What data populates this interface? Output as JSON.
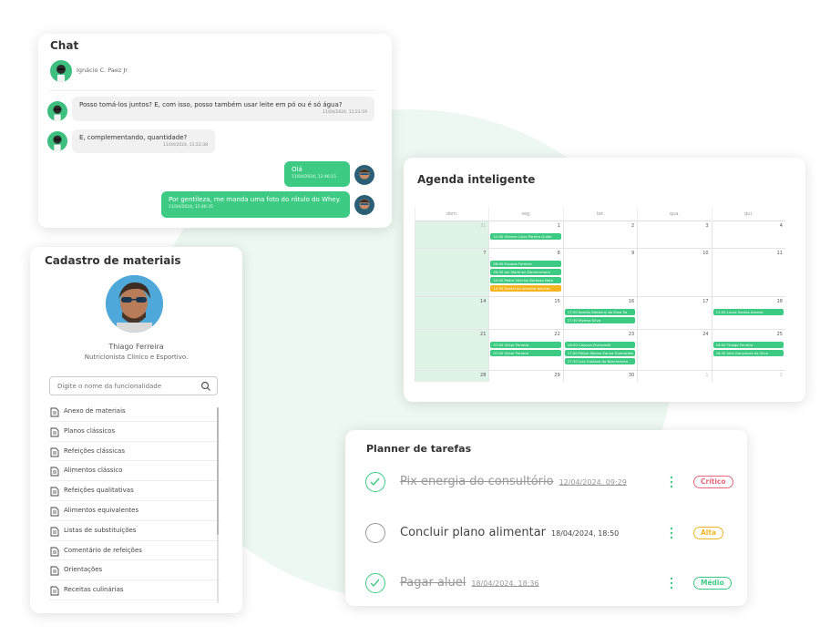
{
  "chat": {
    "title": "Chat",
    "contact_name": "Ignácio C. Paez Jr",
    "messages": [
      {
        "text": "Posso tomá-los juntos? E, com isso, posso também usar leite em pó ou é só água?",
        "time": "11/04/2024, 11:21:59",
        "direction": "in"
      },
      {
        "text": "E, complementando, quantidade?",
        "time": "11/04/2024, 11:22:38",
        "direction": "in"
      },
      {
        "text": "Olá",
        "time": "11/04/2024, 12:46:15",
        "direction": "out"
      },
      {
        "text": "Por gentileza, me manda uma foto do rótulo do Whey.",
        "time": "11/04/2024, 12:46:35",
        "direction": "out"
      }
    ]
  },
  "agenda": {
    "title": "Agenda inteligente",
    "weekdays": [
      "dom.",
      "seg.",
      "ter.",
      "qua.",
      "qui."
    ],
    "weeks": [
      {
        "days": [
          "31",
          "1",
          "2",
          "3",
          "4"
        ],
        "dim": [
          true,
          false,
          false,
          false,
          false
        ],
        "events": [
          {
            "col": 1,
            "slot": 0,
            "text": "11:00 Viviane Lucia Pereira Guiler",
            "color": "green"
          }
        ]
      },
      {
        "days": [
          "7",
          "8",
          "9",
          "10",
          "11"
        ],
        "dim": [
          false,
          false,
          false,
          false,
          false
        ],
        "events": [
          {
            "col": 1,
            "slot": 0,
            "text": "08:00 Enoque Ferreira",
            "color": "green"
          },
          {
            "col": 1,
            "slot": 1,
            "text": "09:30 Ian Martinez Zimmermann",
            "color": "green"
          },
          {
            "col": 1,
            "slot": 2,
            "text": "10:00 Pedro Vinicíus Barbosa Neto",
            "color": "green"
          },
          {
            "col": 1,
            "slot": 3,
            "text": "10:30 Daniel de Almeida Barreto",
            "color": "orange"
          }
        ]
      },
      {
        "days": [
          "14",
          "15",
          "16",
          "17",
          "18"
        ],
        "dim": [
          false,
          false,
          false,
          false,
          false
        ],
        "events": [
          {
            "col": 2,
            "slot": 0,
            "text": "17:00 Kamila Stefanny da Silva Sa",
            "color": "green"
          },
          {
            "col": 2,
            "slot": 1,
            "text": "17:30 Mylena Silva",
            "color": "green"
          },
          {
            "col": 4,
            "slot": 0,
            "text": "11:00 Lucas Santos Amaral",
            "color": "green"
          }
        ]
      },
      {
        "days": [
          "21",
          "22",
          "23",
          "24",
          "25"
        ],
        "dim": [
          false,
          false,
          false,
          false,
          false
        ],
        "events": [
          {
            "col": 1,
            "slot": 0,
            "text": "07:00 Victor Ferreira",
            "color": "green"
          },
          {
            "col": 1,
            "slot": 1,
            "text": "07:00 Victor Ferreira",
            "color": "green"
          },
          {
            "col": 2,
            "slot": 0,
            "text": "16:30 Clayson Portucedil",
            "color": "green"
          },
          {
            "col": 2,
            "slot": 1,
            "text": "17:00 Felipe Afonso Zanna Guimarães",
            "color": "green"
          },
          {
            "col": 2,
            "slot": 2,
            "text": "17:30 Luis Gustavo do Nascimento",
            "color": "green"
          },
          {
            "col": 4,
            "slot": 0,
            "text": "16:00 Thiago Ferreira",
            "color": "green"
          },
          {
            "col": 4,
            "slot": 1,
            "text": "16:30 Júlio Gonçalves da Silva",
            "color": "green"
          }
        ]
      },
      {
        "days": [
          "28",
          "29",
          "30",
          "1",
          "2"
        ],
        "dim": [
          false,
          false,
          false,
          true,
          true
        ],
        "events": []
      }
    ]
  },
  "cadastro": {
    "title": "Cadastro de materiais",
    "name": "Thiago Ferreira",
    "role": "Nutricionista Clínico e Esportivo.",
    "search_placeholder": "Digite o nome da funcionalidade",
    "items": [
      "Anexo de materiais",
      "Planos clássicos",
      "Refeições clássicas",
      "Alimentos clássico",
      "Refeições qualitativas",
      "Alimentos equivalentes",
      "Listas de substituições",
      "Comentário de refeições",
      "Orientações",
      "Receitas culinárias"
    ]
  },
  "planner": {
    "title": "Planner de tarefas",
    "tasks": [
      {
        "name": "Pix energia do consultório",
        "date": "12/04/2024, 09:29",
        "done": true,
        "priority": "Crítico",
        "priority_color": "#e8677a"
      },
      {
        "name": "Concluir plano alimentar",
        "date": "18/04/2024, 18:50",
        "done": false,
        "priority": "Alta",
        "priority_color": "#f0b62a"
      },
      {
        "name": "Pagar aluel",
        "date": "18/04/2024, 18:36",
        "done": true,
        "priority": "Médio",
        "priority_color": "#3dcb83"
      }
    ]
  }
}
